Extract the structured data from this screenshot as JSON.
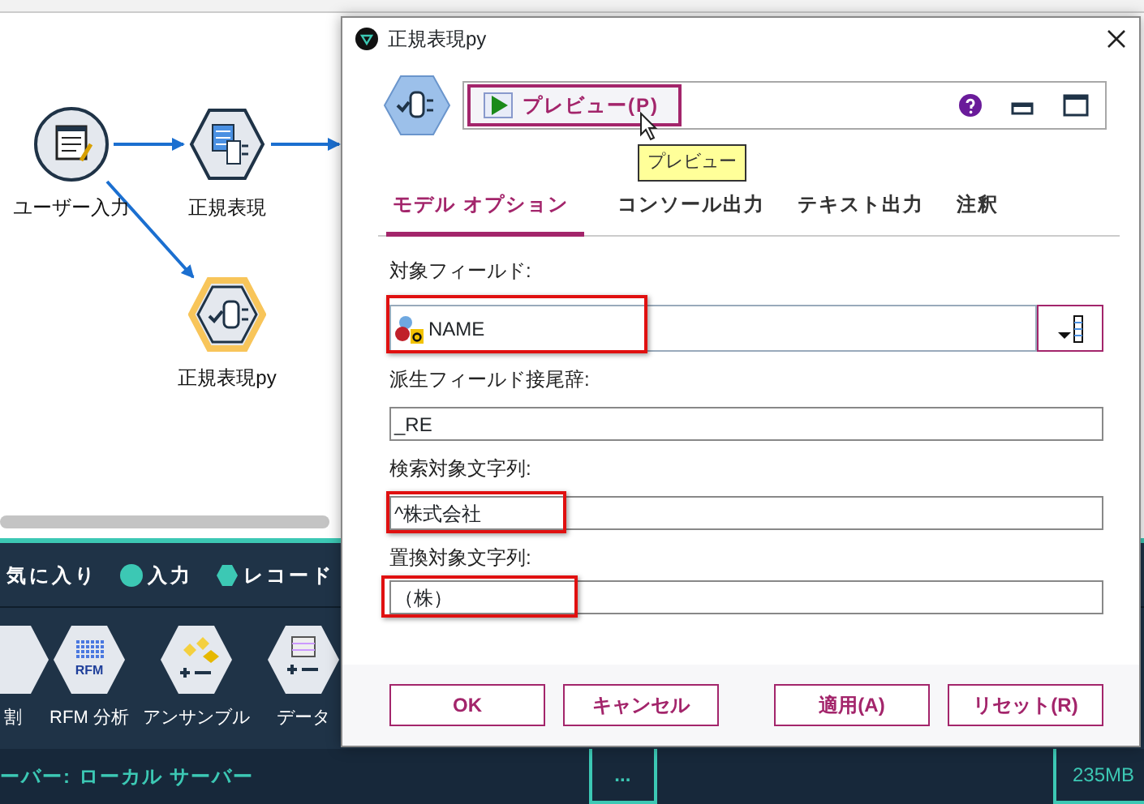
{
  "app": {
    "canvas": {
      "nodes": [
        {
          "label": "ユーザー入力",
          "kind": "source",
          "selected": false
        },
        {
          "label": "正規表現",
          "kind": "regex",
          "selected": false
        },
        {
          "label": "正規表現py",
          "kind": "python",
          "selected": true
        }
      ]
    },
    "palette": {
      "tabs": [
        {
          "label": "気に入り",
          "kind": "plain"
        },
        {
          "label": "入力",
          "kind": "dot"
        },
        {
          "label": "レコード",
          "kind": "hex"
        }
      ],
      "nodes": [
        {
          "label": "割",
          "kind": "plain"
        },
        {
          "label": "RFM 分析",
          "kind": "rfm",
          "icon_text": "RFM"
        },
        {
          "label": "アンサンブル",
          "kind": "ensemble"
        },
        {
          "label": "データ",
          "kind": "data"
        }
      ]
    },
    "status_bar": {
      "server": "ーバー: ローカル サーバー",
      "tasks": "...",
      "memory": "235MB"
    }
  },
  "dialog": {
    "title": "正規表現py",
    "toolbar": {
      "preview_button": "プレビュー(P)",
      "tooltip": "プレビュー"
    },
    "tabs": [
      {
        "label": "モデル オプション",
        "selected": true
      },
      {
        "label": "コンソール出力",
        "selected": false
      },
      {
        "label": "テキスト出力",
        "selected": false
      },
      {
        "label": "注釈",
        "selected": false
      }
    ],
    "fields": [
      {
        "label": "対象フィールド:",
        "value": "NAME",
        "kind": "field_picker",
        "highlighted": true
      },
      {
        "label": "派生フィールド接尾辞:",
        "value": "_RE",
        "kind": "text",
        "highlighted": false
      },
      {
        "label": "検索対象文字列:",
        "value": "^株式会社",
        "kind": "text",
        "highlighted": true
      },
      {
        "label": "置換対象文字列:",
        "value": "（株）",
        "kind": "text",
        "highlighted": true
      }
    ],
    "buttons": [
      "OK",
      "キャンセル",
      "適用(A)",
      "リセット(R)"
    ]
  }
}
